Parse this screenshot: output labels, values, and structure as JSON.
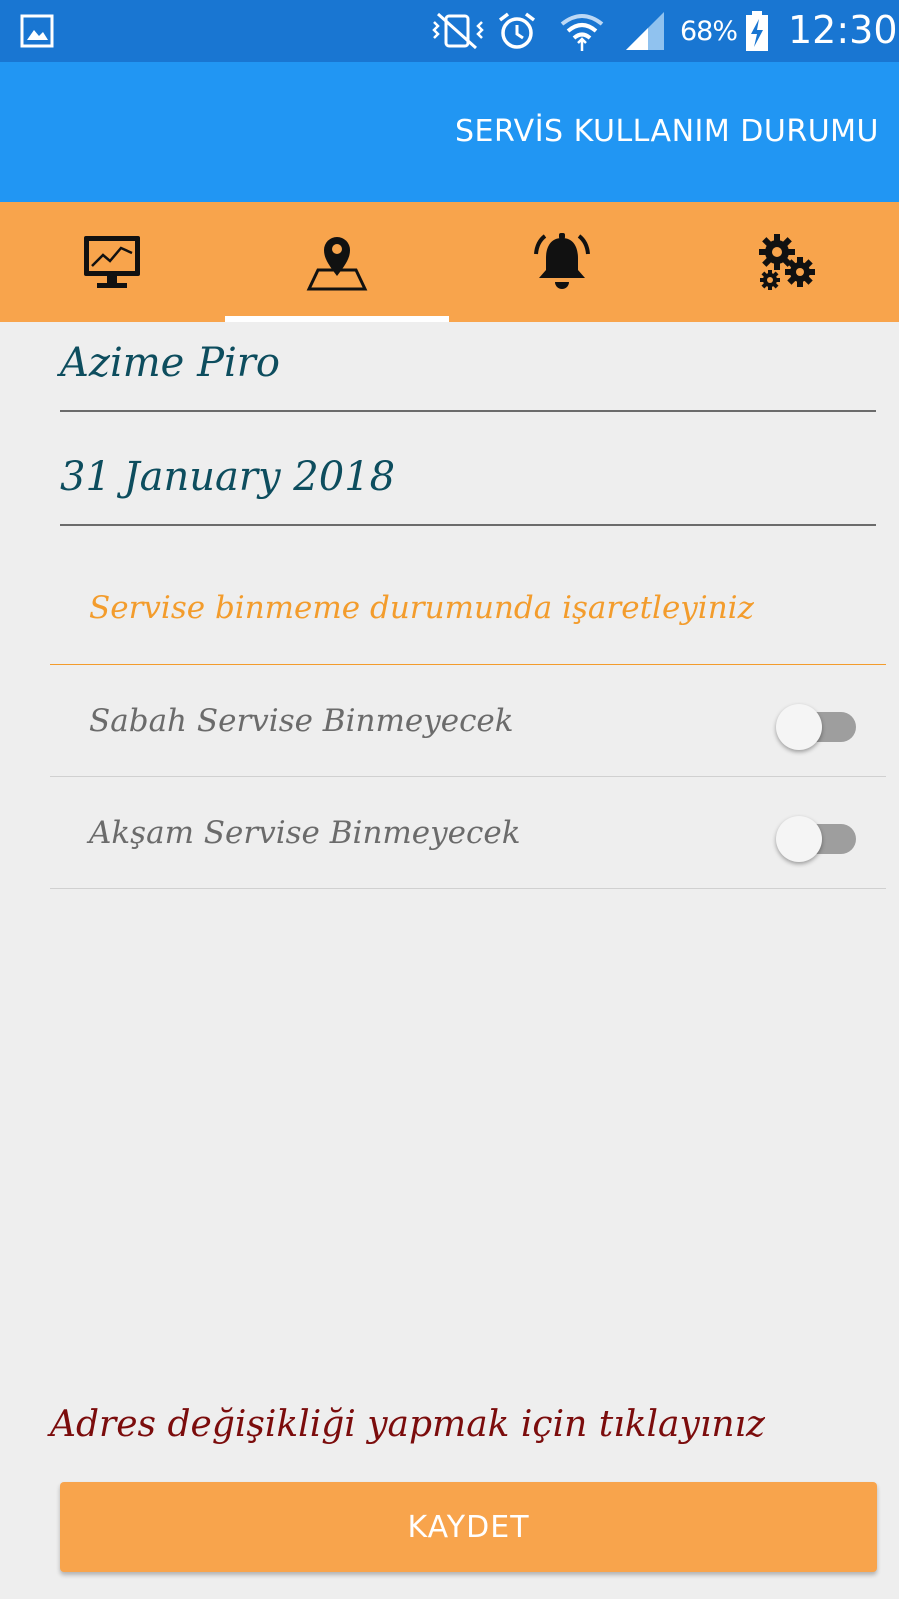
{
  "status_bar": {
    "battery_percent": "68%",
    "time": "12:30",
    "icons": [
      "gallery-icon",
      "vibrate-icon",
      "alarm-icon",
      "wifi-icon",
      "signal-icon",
      "battery-charging-icon"
    ]
  },
  "app_bar": {
    "title": "SERVİS KULLANIM DURUMU"
  },
  "tabs": [
    {
      "icon": "monitor-chart-icon",
      "selected": false
    },
    {
      "icon": "map-pin-icon",
      "selected": true
    },
    {
      "icon": "bell-icon",
      "selected": false
    },
    {
      "icon": "gears-icon",
      "selected": false
    }
  ],
  "form": {
    "name": "Azime  Piro",
    "date": "31 January 2018",
    "section_title": "Servise binmeme durumunda işaretleyiniz",
    "options": [
      {
        "label": "Sabah Servise Binmeyecek",
        "checked": false
      },
      {
        "label": "Akşam Servise Binmeyecek",
        "checked": false
      }
    ],
    "address_link": "Adres değişikliği yapmak için tıklayınız",
    "save_label": "KAYDET"
  },
  "colors": {
    "status_bar": "#1976d2",
    "app_bar": "#2196f3",
    "accent_orange": "#f8a44c",
    "section_title": "#f39c2c",
    "field_text": "#0d4d5e",
    "link_text": "#7b0c0c"
  }
}
